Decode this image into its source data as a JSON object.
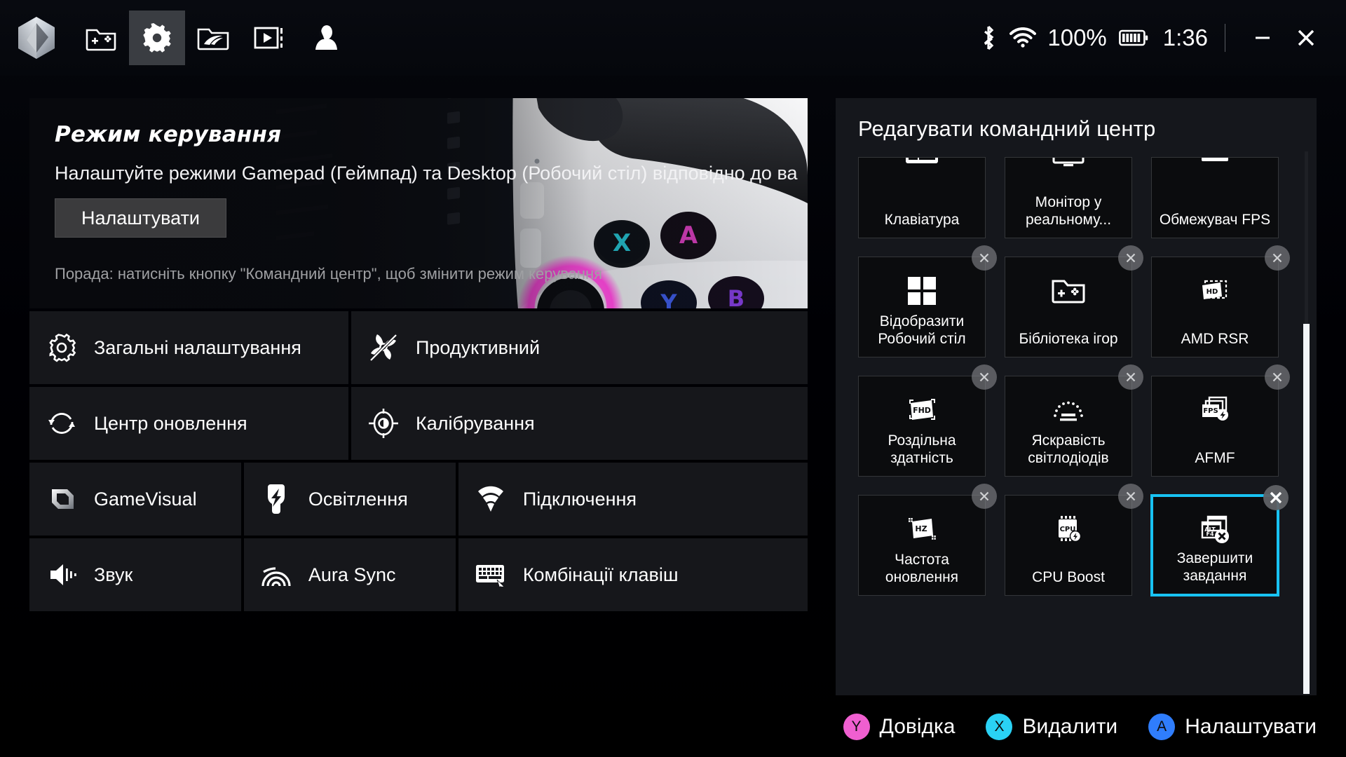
{
  "titlebar": {
    "logo_name": "rog-armoury-crate-logo",
    "tabs": [
      {
        "id": "game-library",
        "icon": "game-folder-icon",
        "active": false
      },
      {
        "id": "settings",
        "icon": "gear-icon",
        "active": true
      },
      {
        "id": "rog-content",
        "icon": "rog-folder-icon",
        "active": false
      },
      {
        "id": "media",
        "icon": "media-player-icon",
        "active": false
      },
      {
        "id": "user-profile",
        "icon": "user-avatar-icon",
        "active": false
      }
    ],
    "status": {
      "bluetooth_icon": "bluetooth-icon",
      "wifi_icon": "wifi-icon",
      "battery_percent": "100%",
      "battery_icon": "battery-full-icon",
      "clock": "1:36",
      "minimize_label": "minimize-icon",
      "close_label": "close-icon"
    }
  },
  "banner": {
    "title": "Режим керування",
    "description": "Налаштуйте режими Gamepad (Геймпад) та Desktop (Робочий стіл) відповідно до ва",
    "button_label": "Налаштувати",
    "tip": "Порада: натисніть кнопку \"Командний центр\", щоб змінити режим керування"
  },
  "settings_tiles": [
    [
      {
        "label": "Загальні налаштування",
        "icon": "gear-outline-icon",
        "size": "r1a"
      },
      {
        "label": "Продуктивний",
        "icon": "fan-performance-icon",
        "size": "r1b"
      }
    ],
    [
      {
        "label": "Центр оновлення",
        "icon": "refresh-update-icon",
        "size": "r2a"
      },
      {
        "label": "Калібрування",
        "icon": "calibration-target-icon",
        "size": "r2b"
      }
    ],
    [
      {
        "label": "GameVisual",
        "icon": "gamevisual-icon",
        "size": "r3a"
      },
      {
        "label": "Освітлення",
        "icon": "lighting-bolt-icon",
        "size": "r3b"
      },
      {
        "label": "Підключення",
        "icon": "connection-wifi-icon",
        "size": "r3c"
      }
    ],
    [
      {
        "label": "Звук",
        "icon": "speaker-sound-icon",
        "size": "r4a"
      },
      {
        "label": "Aura Sync",
        "icon": "aura-sync-icon",
        "size": "r4b"
      },
      {
        "label": "Комбінації клавіш",
        "icon": "keyboard-shortcut-icon",
        "size": "r4c"
      }
    ]
  ],
  "command_center": {
    "title": "Редагувати командний центр",
    "cards": [
      {
        "label": "Клавіатура",
        "icon": "keyboard-icon",
        "clipped": true,
        "removable": false,
        "selected": false
      },
      {
        "label": "Монітор у реальному...",
        "icon": "realtime-monitor-icon",
        "clipped": true,
        "removable": false,
        "selected": false
      },
      {
        "label": "Обмежувач FPS",
        "icon": "fps-limiter-icon",
        "clipped": true,
        "removable": false,
        "selected": false
      },
      {
        "label": "Відобразити Робочий стіл",
        "icon": "show-desktop-icon",
        "clipped": false,
        "removable": true,
        "selected": false
      },
      {
        "label": "Бібліотека ігор",
        "icon": "game-library-folder-icon",
        "clipped": false,
        "removable": true,
        "selected": false
      },
      {
        "label": "AMD RSR",
        "icon": "amd-rsr-hd-icon",
        "clipped": false,
        "removable": true,
        "selected": false
      },
      {
        "label": "Роздільна здатність",
        "icon": "resolution-fhd-icon",
        "clipped": false,
        "removable": true,
        "selected": false
      },
      {
        "label": "Яскравість світлодіодів",
        "icon": "led-brightness-icon",
        "clipped": false,
        "removable": true,
        "selected": false
      },
      {
        "label": "AFMF",
        "icon": "afmf-fps-icon",
        "clipped": false,
        "removable": true,
        "selected": false
      },
      {
        "label": "Частота оновлення",
        "icon": "refresh-rate-hz-icon",
        "clipped": false,
        "removable": true,
        "selected": false
      },
      {
        "label": "CPU Boost",
        "icon": "cpu-boost-icon",
        "clipped": false,
        "removable": true,
        "selected": false
      },
      {
        "label": "Завершити завдання",
        "icon": "end-task-altf4-icon",
        "clipped": false,
        "removable": true,
        "selected": true
      }
    ],
    "remove_icon": "close-x-icon",
    "scrollbar": "vertical-scrollbar"
  },
  "action_bar": [
    {
      "key": "Y",
      "label": "Довідка",
      "color": "#f05fd0"
    },
    {
      "key": "X",
      "label": "Видалити",
      "color": "#2ad2f5"
    },
    {
      "key": "A",
      "label": "Налаштувати",
      "color": "#2f7dfc"
    }
  ]
}
